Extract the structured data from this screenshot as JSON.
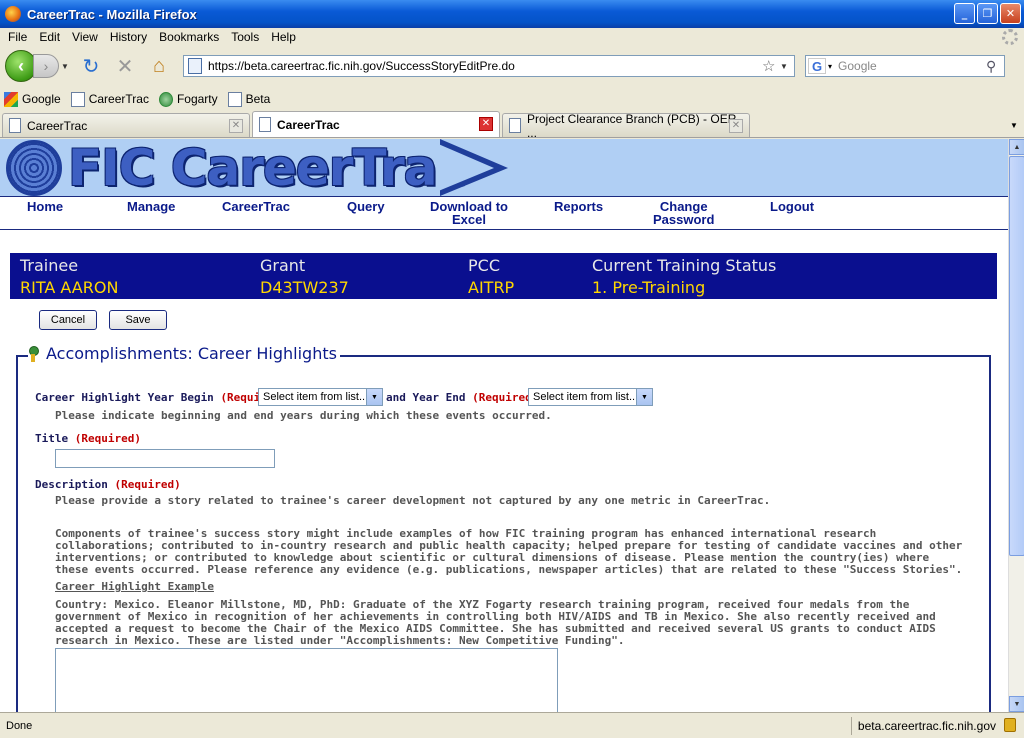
{
  "window": {
    "title": "CareerTrac - Mozilla Firefox"
  },
  "menu": [
    "File",
    "Edit",
    "View",
    "History",
    "Bookmarks",
    "Tools",
    "Help"
  ],
  "toolbar": {
    "url": "https://beta.careertrac.fic.nih.gov/SuccessStoryEditPre.do",
    "search_placeholder": "Google"
  },
  "bookmarks": [
    "Google",
    "CareerTrac",
    "Fogarty",
    "Beta"
  ],
  "tabs": [
    {
      "label": "CareerTrac"
    },
    {
      "label": "CareerTrac"
    },
    {
      "label": "Project Clearance Branch (PCB) - OER ..."
    }
  ],
  "banner": {
    "logo_text": "FIC CareerTrac"
  },
  "nav": {
    "home": "Home",
    "manage": "Manage",
    "careertrac": "CareerTrac",
    "query": "Query",
    "download_1": "Download to",
    "download_2": "Excel",
    "reports": "Reports",
    "change_1": "Change",
    "change_2": "Password",
    "logout": "Logout"
  },
  "info": {
    "trainee_label": "Trainee",
    "trainee_value": "RITA AARON",
    "grant_label": "Grant",
    "grant_value": "D43TW237",
    "pcc_label": "PCC",
    "pcc_value": "AITRP",
    "status_label": "Current Training Status",
    "status_value": "1. Pre-Training"
  },
  "buttons": {
    "cancel": "Cancel",
    "save": "Save"
  },
  "form": {
    "legend": "Accomplishments: Career Highlights",
    "year_begin_label": "Career Highlight Year Begin",
    "required": "(Required)",
    "and_year_end": "and Year End",
    "select_placeholder": "Select item from list...",
    "year_help": "Please indicate beginning and end years during which these events occurred.",
    "title_label": "Title",
    "description_label": "Description",
    "desc_help_1": "Please provide a story related to trainee's career development not captured by any one metric in CareerTrac.",
    "desc_help_2": "Components of trainee's success story might include examples of how FIC training program has enhanced international research collaborations; contributed to in-country research and public health capacity; helped prepare for testing of candidate vaccines and other interventions; or contributed to knowledge about scientific or cultural dimensions of disease. Please mention the country(ies) where these events occurred. Please reference any evidence (e.g. publications, newspaper articles) that are related to these \"Success Stories\".",
    "example_heading": "Career Highlight Example",
    "example_text": "Country: Mexico. Eleanor Millstone, MD, PhD: Graduate of the XYZ Fogarty research training program, received four medals from the government of Mexico in recognition of her achievements in controlling both HIV/AIDS and TB in Mexico. She also recently received and accepted a request to become the Chair of the Mexico AIDS Committee. She has submitted and received several US grants to conduct AIDS research in Mexico. These are listed under \"Accomplishments: New Competitive Funding\"."
  },
  "status": {
    "text": "Done",
    "domain": "beta.careertrac.fic.nih.gov"
  }
}
